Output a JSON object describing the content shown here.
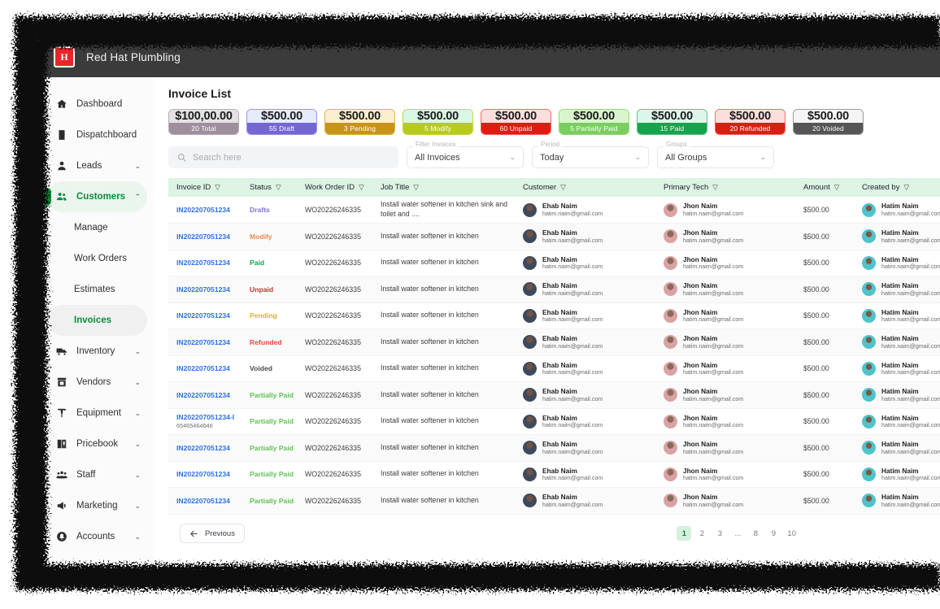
{
  "app": {
    "title": "Red Hat Plumbling",
    "logo_glyph": "H"
  },
  "sidebar": {
    "items": [
      {
        "label": "Dashboard",
        "icon": "home-icon",
        "chevron": "",
        "active": false,
        "type": "item"
      },
      {
        "label": "Dispatchboard",
        "icon": "clipboard-icon",
        "chevron": "",
        "active": false,
        "type": "item"
      },
      {
        "label": "Leads",
        "icon": "person-icon",
        "chevron": "⌄",
        "active": false,
        "type": "item"
      },
      {
        "label": "Customers",
        "icon": "people-icon",
        "chevron": "⌃",
        "active": true,
        "type": "item"
      },
      {
        "label": "Manage",
        "icon": "",
        "chevron": "",
        "active": false,
        "type": "sub"
      },
      {
        "label": "Work Orders",
        "icon": "",
        "chevron": "",
        "active": false,
        "type": "sub"
      },
      {
        "label": "Estimates",
        "icon": "",
        "chevron": "",
        "active": false,
        "type": "sub"
      },
      {
        "label": "Invoices",
        "icon": "",
        "chevron": "",
        "active": true,
        "type": "sub"
      },
      {
        "label": "Inventory",
        "icon": "truck-icon",
        "chevron": "⌄",
        "active": false,
        "type": "item"
      },
      {
        "label": "Vendors",
        "icon": "store-icon",
        "chevron": "⌄",
        "active": false,
        "type": "item"
      },
      {
        "label": "Equipment",
        "icon": "drill-icon",
        "chevron": "⌄",
        "active": false,
        "type": "item"
      },
      {
        "label": "Pricebook",
        "icon": "book-icon",
        "chevron": "⌄",
        "active": false,
        "type": "item"
      },
      {
        "label": "Staff",
        "icon": "group-icon",
        "chevron": "⌄",
        "active": false,
        "type": "item"
      },
      {
        "label": "Marketing",
        "icon": "megaphone-icon",
        "chevron": "⌄",
        "active": false,
        "type": "item"
      },
      {
        "label": "Accounts",
        "icon": "bell-circle-icon",
        "chevron": "⌄",
        "active": false,
        "type": "item"
      }
    ]
  },
  "main": {
    "page_title": "Invoice List",
    "stats": [
      {
        "amount": "$100,00.00",
        "label": "20 Total",
        "top_bg": "#e4e2e4",
        "bar_bg": "#9f8e9d",
        "border": "#b9adb7"
      },
      {
        "amount": "$500.00",
        "label": "55 Draft",
        "top_bg": "#e4ebfb",
        "bar_bg": "#7467d4",
        "border": "#9d95e0"
      },
      {
        "amount": "$500.00",
        "label": "3 Pending",
        "top_bg": "#fdeecd",
        "bar_bg": "#c79419",
        "border": "#dcb54d"
      },
      {
        "amount": "$500.00",
        "label": "5 Modify",
        "top_bg": "#d8f7e5",
        "bar_bg": "#b8cb1c",
        "border": "#c5d64a"
      },
      {
        "amount": "$500.00",
        "label": "60 Unpaid",
        "top_bg": "#fcdedd",
        "bar_bg": "#e01b12",
        "border": "#ef6b64"
      },
      {
        "amount": "$500.00",
        "label": "5 Partially Paid",
        "top_bg": "#d9f5cc",
        "bar_bg": "#7ace60",
        "border": "#96d87e"
      },
      {
        "amount": "$500.00",
        "label": "15 Paid",
        "top_bg": "#ddf6ea",
        "bar_bg": "#17a24c",
        "border": "#5cc389"
      },
      {
        "amount": "$500.00",
        "label": "20 Refunded",
        "top_bg": "#fcdedd",
        "bar_bg": "#d91f12",
        "border": "#ec7068"
      },
      {
        "amount": "$500.00",
        "label": "20 Voided",
        "top_bg": "#f5f5f5",
        "bar_bg": "#555555",
        "border": "#9a9a9a"
      }
    ],
    "search": {
      "placeholder": "Search here",
      "icon": "search-icon"
    },
    "selects": [
      {
        "label": "Filter Invoices",
        "value": "All Invoices"
      },
      {
        "label": "Period",
        "value": "Today"
      },
      {
        "label": "Groups",
        "value": "All Groups"
      }
    ],
    "table": {
      "columns": [
        {
          "label": "Invoice ID",
          "filter": "▽"
        },
        {
          "label": "Status",
          "filter": "▽"
        },
        {
          "label": "Work Order ID",
          "filter": "▽"
        },
        {
          "label": "Job Title",
          "filter": "▽"
        },
        {
          "label": "Customer",
          "filter": "▽"
        },
        {
          "label": "Primary Tech",
          "filter": "▽"
        },
        {
          "label": "Amount",
          "filter": "▽"
        },
        {
          "label": "Created by",
          "filter": "▽"
        }
      ],
      "rows": [
        {
          "invoice_id": "IN202207051234",
          "invoice_sub": "",
          "status": "Drafts",
          "status_color": "#7b73d8",
          "work_order_id": "WO20226246335",
          "job_title": "Install water softener in kitchen sink and toilet and ....",
          "customer_name": "Ehab Naim",
          "customer_email": "hatim.naim@gmail.com",
          "tech_name": "Jhon Naim",
          "tech_email": "hatim.naim@gmail.com",
          "amount": "$500.00",
          "creator_name": "Hatim Naim",
          "creator_email": "hatim.naim@gmail.com"
        },
        {
          "invoice_id": "IN202207051234",
          "invoice_sub": "",
          "status": "Modify",
          "status_color": "#f08a4b",
          "work_order_id": "WO20226246335",
          "job_title": "Install water softener in kitchen",
          "customer_name": "Ehab Naim",
          "customer_email": "hatim.naim@gmail.com",
          "tech_name": "Jhon Naim",
          "tech_email": "hatim.naim@gmail.com",
          "amount": "$500.00",
          "creator_name": "Hatim Naim",
          "creator_email": "hatim.naim@gmail.com"
        },
        {
          "invoice_id": "IN202207051234",
          "invoice_sub": "",
          "status": "Paid",
          "status_color": "#16a34a",
          "work_order_id": "WO20226246335",
          "job_title": "Install water softener in kitchen",
          "customer_name": "Ehab Naim",
          "customer_email": "hatim.naim@gmail.com",
          "tech_name": "Jhon Naim",
          "tech_email": "hatim.naim@gmail.com",
          "amount": "$500.00",
          "creator_name": "Hatim Naim",
          "creator_email": "hatim.naim@gmail.com"
        },
        {
          "invoice_id": "IN202207051234",
          "invoice_sub": "",
          "status": "Unpaid",
          "status_color": "#c0362c",
          "work_order_id": "WO20226246335",
          "job_title": "Install water softener in kitchen",
          "customer_name": "Ehab Naim",
          "customer_email": "hatim.naim@gmail.com",
          "tech_name": "Jhon Naim",
          "tech_email": "hatim.naim@gmail.com",
          "amount": "$500.00",
          "creator_name": "Hatim Naim",
          "creator_email": "hatim.naim@gmail.com"
        },
        {
          "invoice_id": "IN202207051234",
          "invoice_sub": "",
          "status": "Pending",
          "status_color": "#e0b02a",
          "work_order_id": "WO20226246335",
          "job_title": "Install water softener in kitchen",
          "customer_name": "Ehab Naim",
          "customer_email": "hatim.naim@gmail.com",
          "tech_name": "Jhon Naim",
          "tech_email": "hatim.naim@gmail.com",
          "amount": "$500.00",
          "creator_name": "Hatim Naim",
          "creator_email": "hatim.naim@gmail.com"
        },
        {
          "invoice_id": "IN202207051234",
          "invoice_sub": "",
          "status": "Refunded",
          "status_color": "#e8453c",
          "work_order_id": "WO20226246335",
          "job_title": "Install water softener in kitchen",
          "customer_name": "Ehab Naim",
          "customer_email": "hatim.naim@gmail.com",
          "tech_name": "Jhon Naim",
          "tech_email": "hatim.naim@gmail.com",
          "amount": "$500.00",
          "creator_name": "Hatim Naim",
          "creator_email": "hatim.naim@gmail.com"
        },
        {
          "invoice_id": "IN202207051234",
          "invoice_sub": "",
          "status": "Voided",
          "status_color": "#4a4a4a",
          "work_order_id": "WO20226246335",
          "job_title": "Install water softener in kitchen",
          "customer_name": "Ehab Naim",
          "customer_email": "hatim.naim@gmail.com",
          "tech_name": "Jhon Naim",
          "tech_email": "hatim.naim@gmail.com",
          "amount": "$500.00",
          "creator_name": "Hatim Naim",
          "creator_email": "hatim.naim@gmail.com"
        },
        {
          "invoice_id": "IN202207051234",
          "invoice_sub": "",
          "status": "Partially Paid",
          "status_color": "#5fc254",
          "work_order_id": "WO20226246335",
          "job_title": "Install water softener in kitchen",
          "customer_name": "Ehab Naim",
          "customer_email": "hatim.naim@gmail.com",
          "tech_name": "Jhon Naim",
          "tech_email": "hatim.naim@gmail.com",
          "amount": "$500.00",
          "creator_name": "Hatim Naim",
          "creator_email": "hatim.naim@gmail.com"
        },
        {
          "invoice_id": "IN202207051234-I",
          "invoice_sub": "65465464646",
          "status": "Partially Paid",
          "status_color": "#5fc254",
          "work_order_id": "WO20226246335",
          "job_title": "Install water softener in kitchen",
          "customer_name": "Ehab Naim",
          "customer_email": "hatim.naim@gmail.com",
          "tech_name": "Jhon Naim",
          "tech_email": "hatim.naim@gmail.com",
          "amount": "$500.00",
          "creator_name": "Hatim Naim",
          "creator_email": "hatim.naim@gmail.com"
        },
        {
          "invoice_id": "IN202207051234",
          "invoice_sub": "",
          "status": "Partially Paid",
          "status_color": "#5fc254",
          "work_order_id": "WO20226246335",
          "job_title": "Install water softener in kitchen",
          "customer_name": "Ehab Naim",
          "customer_email": "hatim.naim@gmail.com",
          "tech_name": "Jhon Naim",
          "tech_email": "hatim.naim@gmail.com",
          "amount": "$500.00",
          "creator_name": "Hatim Naim",
          "creator_email": "hatim.naim@gmail.com"
        },
        {
          "invoice_id": "IN202207051234",
          "invoice_sub": "",
          "status": "Partially Paid",
          "status_color": "#5fc254",
          "work_order_id": "WO20226246335",
          "job_title": "Install water softener in kitchen",
          "customer_name": "Ehab Naim",
          "customer_email": "hatim.naim@gmail.com",
          "tech_name": "Jhon Naim",
          "tech_email": "hatim.naim@gmail.com",
          "amount": "$500.00",
          "creator_name": "Hatim Naim",
          "creator_email": "hatim.naim@gmail.com"
        },
        {
          "invoice_id": "IN202207051234",
          "invoice_sub": "",
          "status": "Partially Paid",
          "status_color": "#5fc254",
          "work_order_id": "WO20226246335",
          "job_title": "Install water softener in kitchen",
          "customer_name": "Ehab Naim",
          "customer_email": "hatim.naim@gmail.com",
          "tech_name": "Jhon Naim",
          "tech_email": "hatim.naim@gmail.com",
          "amount": "$500.00",
          "creator_name": "Hatim Naim",
          "creator_email": "hatim.naim@gmail.com"
        }
      ]
    },
    "pagination": {
      "previous_label": "Previous",
      "previous_icon": "arrow-left-icon",
      "pages": [
        "1",
        "2",
        "3",
        "...",
        "8",
        "9",
        "10"
      ],
      "active_page": "1"
    }
  }
}
